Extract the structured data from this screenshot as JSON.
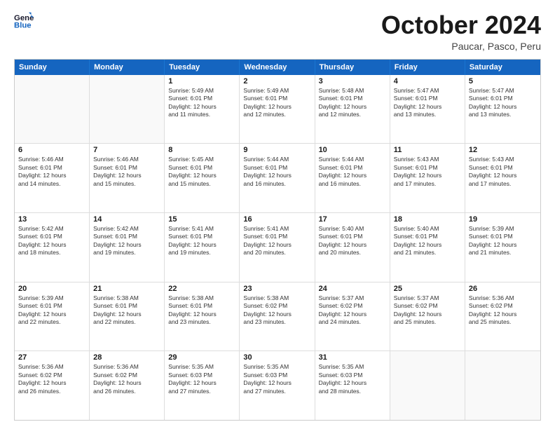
{
  "header": {
    "logo_line1": "General",
    "logo_line2": "Blue",
    "month": "October 2024",
    "location": "Paucar, Pasco, Peru"
  },
  "weekdays": [
    "Sunday",
    "Monday",
    "Tuesday",
    "Wednesday",
    "Thursday",
    "Friday",
    "Saturday"
  ],
  "weeks": [
    [
      {
        "day": "",
        "lines": []
      },
      {
        "day": "",
        "lines": []
      },
      {
        "day": "1",
        "lines": [
          "Sunrise: 5:49 AM",
          "Sunset: 6:01 PM",
          "Daylight: 12 hours",
          "and 11 minutes."
        ]
      },
      {
        "day": "2",
        "lines": [
          "Sunrise: 5:49 AM",
          "Sunset: 6:01 PM",
          "Daylight: 12 hours",
          "and 12 minutes."
        ]
      },
      {
        "day": "3",
        "lines": [
          "Sunrise: 5:48 AM",
          "Sunset: 6:01 PM",
          "Daylight: 12 hours",
          "and 12 minutes."
        ]
      },
      {
        "day": "4",
        "lines": [
          "Sunrise: 5:47 AM",
          "Sunset: 6:01 PM",
          "Daylight: 12 hours",
          "and 13 minutes."
        ]
      },
      {
        "day": "5",
        "lines": [
          "Sunrise: 5:47 AM",
          "Sunset: 6:01 PM",
          "Daylight: 12 hours",
          "and 13 minutes."
        ]
      }
    ],
    [
      {
        "day": "6",
        "lines": [
          "Sunrise: 5:46 AM",
          "Sunset: 6:01 PM",
          "Daylight: 12 hours",
          "and 14 minutes."
        ]
      },
      {
        "day": "7",
        "lines": [
          "Sunrise: 5:46 AM",
          "Sunset: 6:01 PM",
          "Daylight: 12 hours",
          "and 15 minutes."
        ]
      },
      {
        "day": "8",
        "lines": [
          "Sunrise: 5:45 AM",
          "Sunset: 6:01 PM",
          "Daylight: 12 hours",
          "and 15 minutes."
        ]
      },
      {
        "day": "9",
        "lines": [
          "Sunrise: 5:44 AM",
          "Sunset: 6:01 PM",
          "Daylight: 12 hours",
          "and 16 minutes."
        ]
      },
      {
        "day": "10",
        "lines": [
          "Sunrise: 5:44 AM",
          "Sunset: 6:01 PM",
          "Daylight: 12 hours",
          "and 16 minutes."
        ]
      },
      {
        "day": "11",
        "lines": [
          "Sunrise: 5:43 AM",
          "Sunset: 6:01 PM",
          "Daylight: 12 hours",
          "and 17 minutes."
        ]
      },
      {
        "day": "12",
        "lines": [
          "Sunrise: 5:43 AM",
          "Sunset: 6:01 PM",
          "Daylight: 12 hours",
          "and 17 minutes."
        ]
      }
    ],
    [
      {
        "day": "13",
        "lines": [
          "Sunrise: 5:42 AM",
          "Sunset: 6:01 PM",
          "Daylight: 12 hours",
          "and 18 minutes."
        ]
      },
      {
        "day": "14",
        "lines": [
          "Sunrise: 5:42 AM",
          "Sunset: 6:01 PM",
          "Daylight: 12 hours",
          "and 19 minutes."
        ]
      },
      {
        "day": "15",
        "lines": [
          "Sunrise: 5:41 AM",
          "Sunset: 6:01 PM",
          "Daylight: 12 hours",
          "and 19 minutes."
        ]
      },
      {
        "day": "16",
        "lines": [
          "Sunrise: 5:41 AM",
          "Sunset: 6:01 PM",
          "Daylight: 12 hours",
          "and 20 minutes."
        ]
      },
      {
        "day": "17",
        "lines": [
          "Sunrise: 5:40 AM",
          "Sunset: 6:01 PM",
          "Daylight: 12 hours",
          "and 20 minutes."
        ]
      },
      {
        "day": "18",
        "lines": [
          "Sunrise: 5:40 AM",
          "Sunset: 6:01 PM",
          "Daylight: 12 hours",
          "and 21 minutes."
        ]
      },
      {
        "day": "19",
        "lines": [
          "Sunrise: 5:39 AM",
          "Sunset: 6:01 PM",
          "Daylight: 12 hours",
          "and 21 minutes."
        ]
      }
    ],
    [
      {
        "day": "20",
        "lines": [
          "Sunrise: 5:39 AM",
          "Sunset: 6:01 PM",
          "Daylight: 12 hours",
          "and 22 minutes."
        ]
      },
      {
        "day": "21",
        "lines": [
          "Sunrise: 5:38 AM",
          "Sunset: 6:01 PM",
          "Daylight: 12 hours",
          "and 22 minutes."
        ]
      },
      {
        "day": "22",
        "lines": [
          "Sunrise: 5:38 AM",
          "Sunset: 6:01 PM",
          "Daylight: 12 hours",
          "and 23 minutes."
        ]
      },
      {
        "day": "23",
        "lines": [
          "Sunrise: 5:38 AM",
          "Sunset: 6:02 PM",
          "Daylight: 12 hours",
          "and 23 minutes."
        ]
      },
      {
        "day": "24",
        "lines": [
          "Sunrise: 5:37 AM",
          "Sunset: 6:02 PM",
          "Daylight: 12 hours",
          "and 24 minutes."
        ]
      },
      {
        "day": "25",
        "lines": [
          "Sunrise: 5:37 AM",
          "Sunset: 6:02 PM",
          "Daylight: 12 hours",
          "and 25 minutes."
        ]
      },
      {
        "day": "26",
        "lines": [
          "Sunrise: 5:36 AM",
          "Sunset: 6:02 PM",
          "Daylight: 12 hours",
          "and 25 minutes."
        ]
      }
    ],
    [
      {
        "day": "27",
        "lines": [
          "Sunrise: 5:36 AM",
          "Sunset: 6:02 PM",
          "Daylight: 12 hours",
          "and 26 minutes."
        ]
      },
      {
        "day": "28",
        "lines": [
          "Sunrise: 5:36 AM",
          "Sunset: 6:02 PM",
          "Daylight: 12 hours",
          "and 26 minutes."
        ]
      },
      {
        "day": "29",
        "lines": [
          "Sunrise: 5:35 AM",
          "Sunset: 6:03 PM",
          "Daylight: 12 hours",
          "and 27 minutes."
        ]
      },
      {
        "day": "30",
        "lines": [
          "Sunrise: 5:35 AM",
          "Sunset: 6:03 PM",
          "Daylight: 12 hours",
          "and 27 minutes."
        ]
      },
      {
        "day": "31",
        "lines": [
          "Sunrise: 5:35 AM",
          "Sunset: 6:03 PM",
          "Daylight: 12 hours",
          "and 28 minutes."
        ]
      },
      {
        "day": "",
        "lines": []
      },
      {
        "day": "",
        "lines": []
      }
    ]
  ]
}
